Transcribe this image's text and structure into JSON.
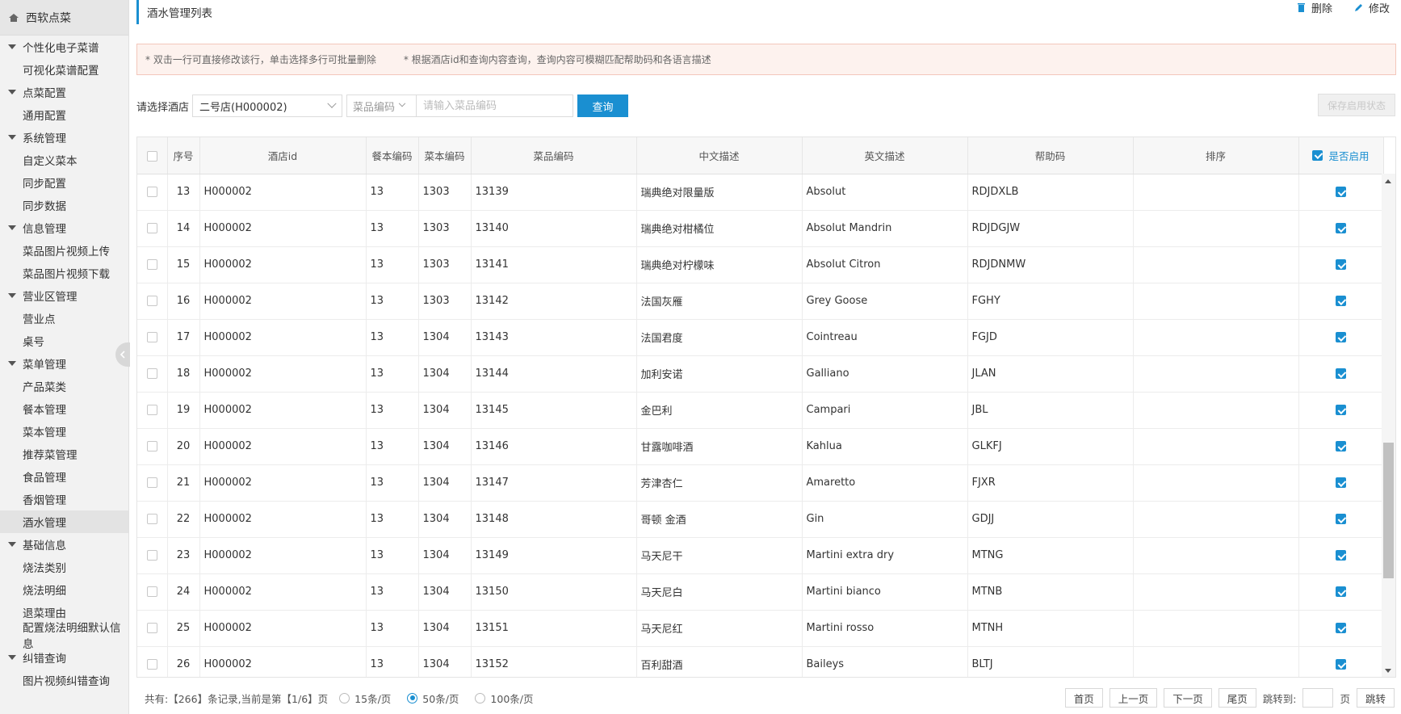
{
  "sidebar": {
    "brand": "西软点菜",
    "groups": [
      {
        "title": "个性化电子菜谱",
        "items": [
          "可视化菜谱配置"
        ]
      },
      {
        "title": "点菜配置",
        "items": [
          "通用配置"
        ]
      },
      {
        "title": "系统管理",
        "items": [
          "自定义菜本",
          "同步配置",
          "同步数据"
        ]
      },
      {
        "title": "信息管理",
        "items": [
          "菜品图片视频上传",
          "菜品图片视频下载"
        ]
      },
      {
        "title": "营业区管理",
        "items": [
          "营业点",
          "桌号"
        ]
      },
      {
        "title": "菜单管理",
        "items": [
          "产品菜类",
          "餐本管理",
          "菜本管理",
          "推荐菜管理",
          "食品管理",
          "香烟管理",
          "酒水管理"
        ]
      },
      {
        "title": "基础信息",
        "items": [
          "烧法类别",
          "烧法明细",
          "退菜理由",
          "配置烧法明细默认信息"
        ]
      },
      {
        "title": "纠错查询",
        "items": [
          "图片视频纠错查询"
        ]
      }
    ],
    "active_item": "酒水管理"
  },
  "header": {
    "title": "酒水管理列表",
    "delete_label": "删除",
    "edit_label": "修改"
  },
  "notice": {
    "tip1": "* 双击一行可直接修改该行，单击选择多行可批量删除",
    "tip2": "* 根据酒店id和查询内容查询，查询内容可模糊匹配帮助码和各语言描述"
  },
  "filter": {
    "hotel_label": "请选择酒店",
    "hotel_value": "二号店(H000002)",
    "code_type": "菜品编码",
    "code_placeholder": "请输入菜品编码",
    "query_label": "查询",
    "save_label": "保存启用状态"
  },
  "table": {
    "columns": [
      "序号",
      "酒店id",
      "餐本编码",
      "菜本编码",
      "菜品编码",
      "中文描述",
      "英文描述",
      "帮助码",
      "排序",
      "是否启用"
    ],
    "rows": [
      {
        "no": "13",
        "hotel": "H000002",
        "menu": "13",
        "book": "1303",
        "code": "13139",
        "cn": "瑞典绝对限量版",
        "en": "Absolut",
        "help": "RDJDXLB",
        "sort": "",
        "enabled": true
      },
      {
        "no": "14",
        "hotel": "H000002",
        "menu": "13",
        "book": "1303",
        "code": "13140",
        "cn": "瑞典绝对柑橘位",
        "en": "Absolut Mandrin",
        "help": "RDJDGJW",
        "sort": "",
        "enabled": true
      },
      {
        "no": "15",
        "hotel": "H000002",
        "menu": "13",
        "book": "1303",
        "code": "13141",
        "cn": "瑞典绝对柠檬味",
        "en": "Absolut Citron",
        "help": "RDJDNMW",
        "sort": "",
        "enabled": true
      },
      {
        "no": "16",
        "hotel": "H000002",
        "menu": "13",
        "book": "1303",
        "code": "13142",
        "cn": "法国灰雁",
        "en": "Grey Goose",
        "help": "FGHY",
        "sort": "",
        "enabled": true
      },
      {
        "no": "17",
        "hotel": "H000002",
        "menu": "13",
        "book": "1304",
        "code": "13143",
        "cn": "法国君度",
        "en": "Cointreau",
        "help": "FGJD",
        "sort": "",
        "enabled": true
      },
      {
        "no": "18",
        "hotel": "H000002",
        "menu": "13",
        "book": "1304",
        "code": "13144",
        "cn": "加利安诺",
        "en": "Galliano",
        "help": "JLAN",
        "sort": "",
        "enabled": true
      },
      {
        "no": "19",
        "hotel": "H000002",
        "menu": "13",
        "book": "1304",
        "code": "13145",
        "cn": "金巴利",
        "en": "Campari",
        "help": "JBL",
        "sort": "",
        "enabled": true
      },
      {
        "no": "20",
        "hotel": "H000002",
        "menu": "13",
        "book": "1304",
        "code": "13146",
        "cn": "甘露咖啡酒",
        "en": "Kahlua",
        "help": "GLKFJ",
        "sort": "",
        "enabled": true
      },
      {
        "no": "21",
        "hotel": "H000002",
        "menu": "13",
        "book": "1304",
        "code": "13147",
        "cn": "芳津杏仁",
        "en": "Amaretto",
        "help": "FJXR",
        "sort": "",
        "enabled": true
      },
      {
        "no": "22",
        "hotel": "H000002",
        "menu": "13",
        "book": "1304",
        "code": "13148",
        "cn": "哥顿 金酒",
        "en": "Gin",
        "help": "GDJJ",
        "sort": "",
        "enabled": true
      },
      {
        "no": "23",
        "hotel": "H000002",
        "menu": "13",
        "book": "1304",
        "code": "13149",
        "cn": "马天尼干",
        "en": "Martini extra dry",
        "help": "MTNG",
        "sort": "",
        "enabled": true
      },
      {
        "no": "24",
        "hotel": "H000002",
        "menu": "13",
        "book": "1304",
        "code": "13150",
        "cn": "马天尼白",
        "en": "Martini bianco",
        "help": "MTNB",
        "sort": "",
        "enabled": true
      },
      {
        "no": "25",
        "hotel": "H000002",
        "menu": "13",
        "book": "1304",
        "code": "13151",
        "cn": "马天尼红",
        "en": "Martini rosso",
        "help": "MTNH",
        "sort": "",
        "enabled": true
      },
      {
        "no": "26",
        "hotel": "H000002",
        "menu": "13",
        "book": "1304",
        "code": "13152",
        "cn": "百利甜酒",
        "en": "Baileys",
        "help": "BLTJ",
        "sort": "",
        "enabled": true
      }
    ]
  },
  "pager": {
    "info": "共有:【266】条记录,当前是第【1/6】页",
    "sizes": [
      {
        "label": "15条/页",
        "selected": false
      },
      {
        "label": "50条/页",
        "selected": true
      },
      {
        "label": "100条/页",
        "selected": false
      }
    ],
    "first": "首页",
    "prev": "上一页",
    "next": "下一页",
    "last": "尾页",
    "jump_label": "跳转到:",
    "page_unit": "页",
    "jump_btn": "跳转"
  },
  "colors": {
    "accent": "#1a8fd1",
    "notice_bg": "#fdf2ee",
    "notice_border": "#f3c7bb"
  }
}
